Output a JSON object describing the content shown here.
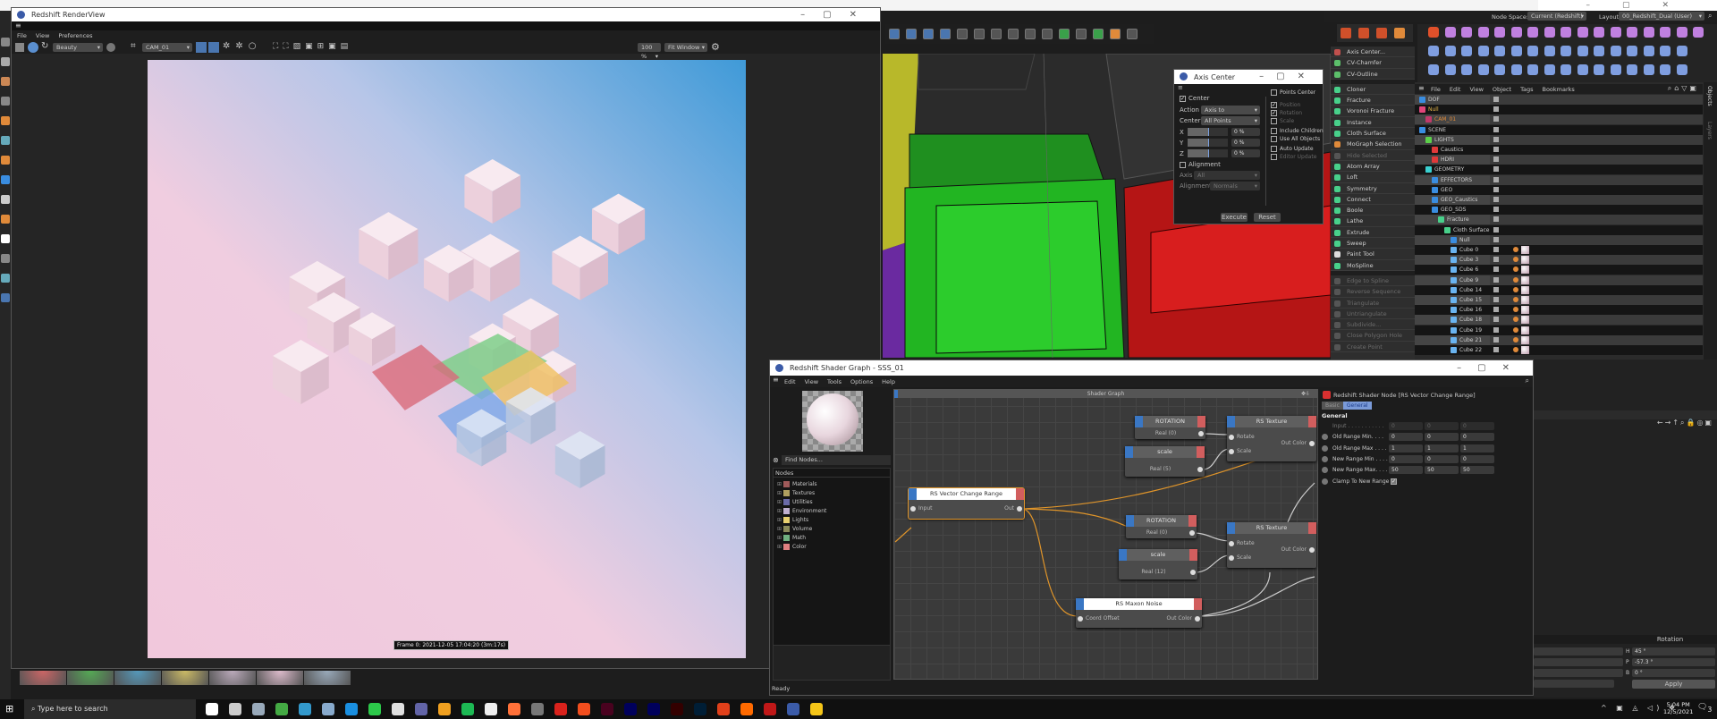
{
  "renderview": {
    "title": "Redshift RenderView",
    "menu": [
      "File",
      "View",
      "Preferences"
    ],
    "aov": "Beauty",
    "camera": "CAM_01",
    "zoom": "100 %",
    "fit": "Fit Window",
    "frame_label": "Frame 0: 2021-12-05 17:04:20 (3m:17s)",
    "snapshot_count": 7
  },
  "top_bar": {
    "node_space_label": "Node Space:",
    "node_space_value": "Current (Redshift)",
    "layout_label": "Layout:",
    "layout_value": "00_Redshift_Dual (User)"
  },
  "axis_center": {
    "title": "Axis Center",
    "center_label": "Center",
    "center_checked": true,
    "action_label": "Action",
    "action_value": "Axis to",
    "center_field_label": "Center",
    "center_value": "All Points",
    "x_label": "X",
    "x_value": "0 %",
    "y_label": "Y",
    "y_value": "0 %",
    "z_label": "Z",
    "z_value": "0 %",
    "alignment_check": "Alignment",
    "axis_label": "Axis",
    "axis_value": "All",
    "alignment_label": "Alignment",
    "alignment_value": "Normals",
    "right_options": [
      {
        "label": "Points Center",
        "checked": false,
        "disabled": false
      },
      {
        "label": "Position",
        "checked": true,
        "disabled": true
      },
      {
        "label": "Rotation",
        "checked": true,
        "disabled": true
      },
      {
        "label": "Scale",
        "checked": false,
        "disabled": true
      },
      {
        "label": "Include Children",
        "checked": false,
        "disabled": false
      },
      {
        "label": "Use All Objects",
        "checked": false,
        "disabled": false
      },
      {
        "label": "Auto Update",
        "checked": false,
        "disabled": false
      },
      {
        "label": "Editor Update",
        "checked": false,
        "disabled": true
      }
    ],
    "execute": "Execute",
    "reset": "Reset"
  },
  "commands": [
    {
      "label": "Axis Center...",
      "color": "#c0504d",
      "disabled": false
    },
    {
      "label": "CV-Chamfer",
      "color": "#5cbf6a",
      "disabled": false
    },
    {
      "label": "CV-Outline",
      "color": "#5cbf6a",
      "disabled": false
    },
    {
      "label": "Cloner",
      "color": "#48d08a",
      "disabled": false
    },
    {
      "label": "Fracture",
      "color": "#48d08a",
      "disabled": false
    },
    {
      "label": "Voronoi Fracture",
      "color": "#48d08a",
      "disabled": false
    },
    {
      "label": "Instance",
      "color": "#48d08a",
      "disabled": false
    },
    {
      "label": "Cloth Surface",
      "color": "#48d08a",
      "disabled": false
    },
    {
      "label": "MoGraph Selection",
      "color": "#e08a3a",
      "disabled": false
    },
    {
      "label": "Hide Selected",
      "color": "#555",
      "disabled": true
    },
    {
      "label": "Atom Array",
      "color": "#48d08a",
      "disabled": false
    },
    {
      "label": "Loft",
      "color": "#48d08a",
      "disabled": false
    },
    {
      "label": "Symmetry",
      "color": "#48d08a",
      "disabled": false
    },
    {
      "label": "Connect",
      "color": "#48d08a",
      "disabled": false
    },
    {
      "label": "Boole",
      "color": "#48d08a",
      "disabled": false
    },
    {
      "label": "Lathe",
      "color": "#48d08a",
      "disabled": false
    },
    {
      "label": "Extrude",
      "color": "#48d08a",
      "disabled": false
    },
    {
      "label": "Sweep",
      "color": "#48d08a",
      "disabled": false
    },
    {
      "label": "Paint Tool",
      "color": "#dddddd",
      "disabled": false
    },
    {
      "label": "MoSpline",
      "color": "#48d08a",
      "disabled": false
    },
    {
      "label": "Edge to Spline",
      "color": "#555",
      "disabled": true
    },
    {
      "label": "Reverse Sequence",
      "color": "#555",
      "disabled": true
    },
    {
      "label": "Triangulate",
      "color": "#555",
      "disabled": true
    },
    {
      "label": "Untriangulate",
      "color": "#555",
      "disabled": true
    },
    {
      "label": "Subdivide...",
      "color": "#555",
      "disabled": true
    },
    {
      "label": "Close Polygon Hole",
      "color": "#555",
      "disabled": true
    },
    {
      "label": "Create Point",
      "color": "#555",
      "disabled": true
    }
  ],
  "object_manager": {
    "menu": [
      "File",
      "Edit",
      "View",
      "Object",
      "Tags",
      "Bookmarks"
    ],
    "side_tabs": [
      "Objects",
      "Layers"
    ],
    "objects": [
      {
        "name": "DOF",
        "depth": 0,
        "color": "#cfcfcf",
        "icon": "#3a8de0"
      },
      {
        "name": "Null",
        "depth": 0,
        "color": "#e8b84a",
        "icon": "#e0457a"
      },
      {
        "name": "CAM_01",
        "depth": 1,
        "color": "#e08a3a",
        "icon": "#c0396a"
      },
      {
        "name": "SCENE",
        "depth": 0,
        "color": "#cfcfcf",
        "icon": "#3a8de0"
      },
      {
        "name": "LIGHTS",
        "depth": 1,
        "color": "#cfcfcf",
        "icon": "#5cd04a"
      },
      {
        "name": "Caustics",
        "depth": 2,
        "color": "#cfcfcf",
        "icon": "#e03a3a"
      },
      {
        "name": "HDRI",
        "depth": 2,
        "color": "#cfcfcf",
        "icon": "#e03a3a"
      },
      {
        "name": "GEOMETRY",
        "depth": 1,
        "color": "#cfcfcf",
        "icon": "#3ad0d0"
      },
      {
        "name": "EFFECTORS",
        "depth": 2,
        "color": "#cfcfcf",
        "icon": "#3a8de0"
      },
      {
        "name": "GEO",
        "depth": 2,
        "color": "#cfcfcf",
        "icon": "#3a8de0"
      },
      {
        "name": "GEO_Caustics",
        "depth": 2,
        "color": "#cfcfcf",
        "icon": "#3a8de0"
      },
      {
        "name": "GEO_SDS",
        "depth": 2,
        "color": "#cfcfcf",
        "icon": "#3a8de0"
      },
      {
        "name": "Fracture",
        "depth": 3,
        "color": "#cfcfcf",
        "icon": "#48d08a"
      },
      {
        "name": "Cloth Surface",
        "depth": 4,
        "color": "#cfcfcf",
        "icon": "#48d08a"
      },
      {
        "name": "Null",
        "depth": 5,
        "color": "#cfcfcf",
        "icon": "#3a8de0"
      },
      {
        "name": "Cube 0",
        "depth": 5,
        "color": "#cfcfcf",
        "icon": "#6ab4f0"
      },
      {
        "name": "Cube 3",
        "depth": 5,
        "color": "#cfcfcf",
        "icon": "#6ab4f0"
      },
      {
        "name": "Cube 6",
        "depth": 5,
        "color": "#cfcfcf",
        "icon": "#6ab4f0"
      },
      {
        "name": "Cube 9",
        "depth": 5,
        "color": "#cfcfcf",
        "icon": "#6ab4f0"
      },
      {
        "name": "Cube 14",
        "depth": 5,
        "color": "#cfcfcf",
        "icon": "#6ab4f0"
      },
      {
        "name": "Cube 15",
        "depth": 5,
        "color": "#cfcfcf",
        "icon": "#6ab4f0"
      },
      {
        "name": "Cube 16",
        "depth": 5,
        "color": "#cfcfcf",
        "icon": "#6ab4f0"
      },
      {
        "name": "Cube 18",
        "depth": 5,
        "color": "#cfcfcf",
        "icon": "#6ab4f0"
      },
      {
        "name": "Cube 19",
        "depth": 5,
        "color": "#cfcfcf",
        "icon": "#6ab4f0"
      },
      {
        "name": "Cube 21",
        "depth": 5,
        "color": "#cfcfcf",
        "icon": "#6ab4f0"
      },
      {
        "name": "Cube 22",
        "depth": 5,
        "color": "#cfcfcf",
        "icon": "#6ab4f0"
      }
    ]
  },
  "shader_graph": {
    "title": "Redshift Shader Graph - SSS_01",
    "menu": [
      "Edit",
      "View",
      "Tools",
      "Options",
      "Help"
    ],
    "find_placeholder": "Find Nodes...",
    "nodes_header": "Nodes",
    "categories": [
      {
        "label": "Materials",
        "color": "#a05a5a"
      },
      {
        "label": "Textures",
        "color": "#b0a060"
      },
      {
        "label": "Utilities",
        "color": "#6a6aa8"
      },
      {
        "label": "Environment",
        "color": "#c0b0d0"
      },
      {
        "label": "Lights",
        "color": "#e8d070"
      },
      {
        "label": "Volume",
        "color": "#8a8a5a"
      },
      {
        "label": "Math",
        "color": "#70b080"
      },
      {
        "label": "Color",
        "color": "#e08080"
      }
    ],
    "graph_title": "Shader Graph",
    "nodes": {
      "vcr": {
        "title": "RS Vector Change Range",
        "in": "Input",
        "out": "Out"
      },
      "rot1": {
        "title": "ROTATION",
        "out": "Real (0)"
      },
      "scale1": {
        "title": "scale",
        "out": "Real (5)"
      },
      "tex1": {
        "title": "RS Texture",
        "in1": "Rotate",
        "in2": "Scale",
        "out": "Out Color"
      },
      "rot2": {
        "title": "ROTATION",
        "out": "Real (0)"
      },
      "scale2": {
        "title": "scale",
        "out": "Real (12)"
      },
      "tex2": {
        "title": "RS Texture",
        "in1": "Rotate",
        "in2": "Scale",
        "out": "Out Color"
      },
      "noise": {
        "title": "RS Maxon Noise",
        "in": "Coord Offset",
        "out": "Out Color"
      }
    },
    "status": "Ready"
  },
  "node_attributes": {
    "title": "Redshift Shader Node [RS Vector Change Range]",
    "tabs": [
      {
        "label": "Basic",
        "active": false
      },
      {
        "label": "General",
        "active": true
      }
    ],
    "section": "General",
    "params": [
      {
        "label": "Input . . . . . . . . . . .",
        "values": [
          "0",
          "0",
          "0"
        ],
        "disabled": true
      },
      {
        "label": "Old Range Min. . . .",
        "values": [
          "0",
          "0",
          "0"
        ],
        "disabled": false
      },
      {
        "label": "Old Range Max . . . .",
        "values": [
          "1",
          "1",
          "1"
        ],
        "disabled": false
      },
      {
        "label": "New Range Min . . . .",
        "values": [
          "0",
          "0",
          "0"
        ],
        "disabled": false
      },
      {
        "label": "New Range Max. . . .",
        "values": [
          "50",
          "50",
          "50"
        ],
        "disabled": false
      }
    ],
    "clamp_label": "Clamp To New Range",
    "clamp_checked": true
  },
  "coordinates": {
    "header": "Rotation",
    "h_label": "H",
    "h_value": "45 °",
    "p_label": "P",
    "p_value": "-57.3 °",
    "b_label": "B",
    "b_value": "0 °",
    "apply": "Apply"
  },
  "taskbar": {
    "search_placeholder": "Type here to search",
    "apps": [
      {
        "name": "cortana-icon",
        "color": "#ffffff"
      },
      {
        "name": "task-view-icon",
        "color": "#cccccc"
      },
      {
        "name": "explorer-icon",
        "color": "#9ab"
      },
      {
        "name": "maps-icon",
        "color": "#4a4"
      },
      {
        "name": "photos-icon",
        "color": "#39c"
      },
      {
        "name": "calculator-icon",
        "color": "#8ac"
      },
      {
        "name": "skype-icon",
        "color": "#1a8fe0"
      },
      {
        "name": "whatsapp-icon",
        "color": "#2cc84a"
      },
      {
        "name": "slack-icon",
        "color": "#e0e0e0"
      },
      {
        "name": "teams-icon",
        "color": "#6264a7"
      },
      {
        "name": "thunderbird-icon",
        "color": "#f0a020"
      },
      {
        "name": "spotify-icon",
        "color": "#1db954"
      },
      {
        "name": "c-app-icon",
        "color": "#eeeeee"
      },
      {
        "name": "firefox-icon",
        "color": "#ff7139"
      },
      {
        "name": "terminal-icon",
        "color": "#777"
      },
      {
        "name": "acrobat-icon",
        "color": "#d9221c"
      },
      {
        "name": "figma-icon",
        "color": "#f24e1e"
      },
      {
        "name": "indesign-icon",
        "color": "#49021f"
      },
      {
        "name": "media-encoder-icon",
        "color": "#00005b"
      },
      {
        "name": "after-effects-icon",
        "color": "#00005b"
      },
      {
        "name": "illustrator-icon",
        "color": "#330000"
      },
      {
        "name": "photoshop-icon",
        "color": "#001e36"
      },
      {
        "name": "redshift-icon",
        "color": "#e0401a"
      },
      {
        "name": "houdini-icon",
        "color": "#ff6a00"
      },
      {
        "name": "maxon-icon",
        "color": "#c01818"
      },
      {
        "name": "cinema4d-icon",
        "color": "#3b5ba8"
      },
      {
        "name": "file-explorer-icon",
        "color": "#f5c518"
      }
    ],
    "time": "5:04 PM",
    "date": "12/5/2021",
    "notifications": "3"
  },
  "colors": {
    "accent": "#3a77c4",
    "node_out": "#d25e5e",
    "wire": "#e0952a"
  }
}
